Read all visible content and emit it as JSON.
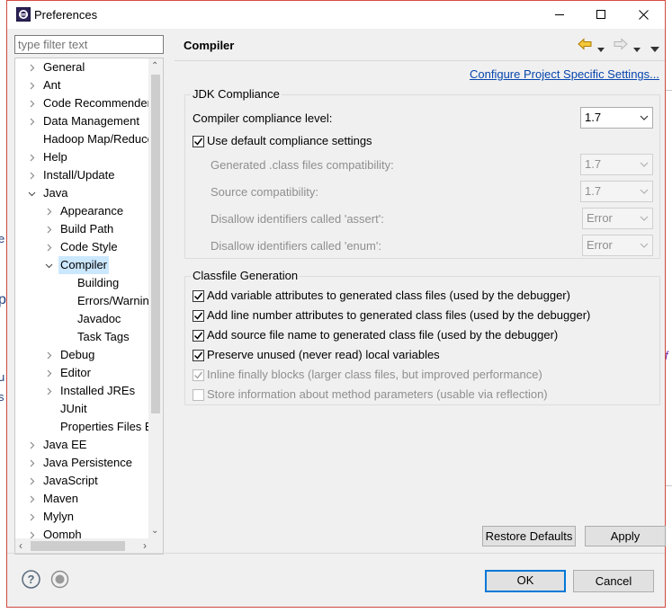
{
  "window": {
    "title": "Preferences"
  },
  "filter": {
    "placeholder": "type filter text"
  },
  "tree": {
    "items": [
      {
        "label": "General",
        "expander": "collapsed"
      },
      {
        "label": "Ant",
        "expander": "collapsed"
      },
      {
        "label": "Code Recommenders",
        "expander": "collapsed"
      },
      {
        "label": "Data Management",
        "expander": "collapsed"
      },
      {
        "label": "Hadoop Map/Reduce",
        "expander": "none"
      },
      {
        "label": "Help",
        "expander": "collapsed"
      },
      {
        "label": "Install/Update",
        "expander": "collapsed"
      },
      {
        "label": "Java",
        "expander": "expanded"
      },
      {
        "label": "Appearance",
        "expander": "collapsed"
      },
      {
        "label": "Build Path",
        "expander": "collapsed"
      },
      {
        "label": "Code Style",
        "expander": "collapsed"
      },
      {
        "label": "Compiler",
        "expander": "expanded",
        "selected": true
      },
      {
        "label": "Building",
        "expander": "none"
      },
      {
        "label": "Errors/Warnings",
        "expander": "none"
      },
      {
        "label": "Javadoc",
        "expander": "none"
      },
      {
        "label": "Task Tags",
        "expander": "none"
      },
      {
        "label": "Debug",
        "expander": "collapsed"
      },
      {
        "label": "Editor",
        "expander": "collapsed"
      },
      {
        "label": "Installed JREs",
        "expander": "collapsed"
      },
      {
        "label": "JUnit",
        "expander": "none"
      },
      {
        "label": "Properties Files Editor",
        "expander": "none"
      },
      {
        "label": "Java EE",
        "expander": "collapsed"
      },
      {
        "label": "Java Persistence",
        "expander": "collapsed"
      },
      {
        "label": "JavaScript",
        "expander": "collapsed"
      },
      {
        "label": "Maven",
        "expander": "collapsed"
      },
      {
        "label": "Mylyn",
        "expander": "collapsed"
      },
      {
        "label": "Oomph",
        "expander": "collapsed"
      }
    ]
  },
  "page": {
    "title": "Compiler",
    "configure_link": "Configure Project Specific Settings...",
    "jdk_group": {
      "title": "JDK Compliance",
      "compliance_label": "Compiler compliance level:",
      "compliance_value": "1.7",
      "use_default_label": "Use default compliance settings",
      "use_default_checked": true,
      "generated_label": "Generated .class files compatibility:",
      "generated_value": "1.7",
      "source_label": "Source compatibility:",
      "source_value": "1.7",
      "assert_label": "Disallow identifiers called 'assert':",
      "assert_value": "Error",
      "enum_label": "Disallow identifiers called 'enum':",
      "enum_value": "Error"
    },
    "classfile_group": {
      "title": "Classfile Generation",
      "options": [
        {
          "label": "Add variable attributes to generated class files (used by the debugger)",
          "checked": true,
          "enabled": true
        },
        {
          "label": "Add line number attributes to generated class files (used by the debugger)",
          "checked": true,
          "enabled": true
        },
        {
          "label": "Add source file name to generated class file (used by the debugger)",
          "checked": true,
          "enabled": true
        },
        {
          "label": "Preserve unused (never read) local variables",
          "checked": true,
          "enabled": true
        },
        {
          "label": "Inline finally blocks (larger class files, but improved performance)",
          "checked": true,
          "enabled": false
        },
        {
          "label": "Store information about method parameters (usable via reflection)",
          "checked": false,
          "enabled": false
        }
      ]
    },
    "restore_defaults_label": "Restore Defaults",
    "apply_label": "Apply"
  },
  "footer": {
    "ok_label": "OK",
    "cancel_label": "Cancel"
  },
  "colors": {
    "accent": "#0078d7",
    "selection": "#cce8ff",
    "link": "#0645ad",
    "window_border": "#d64c44"
  }
}
